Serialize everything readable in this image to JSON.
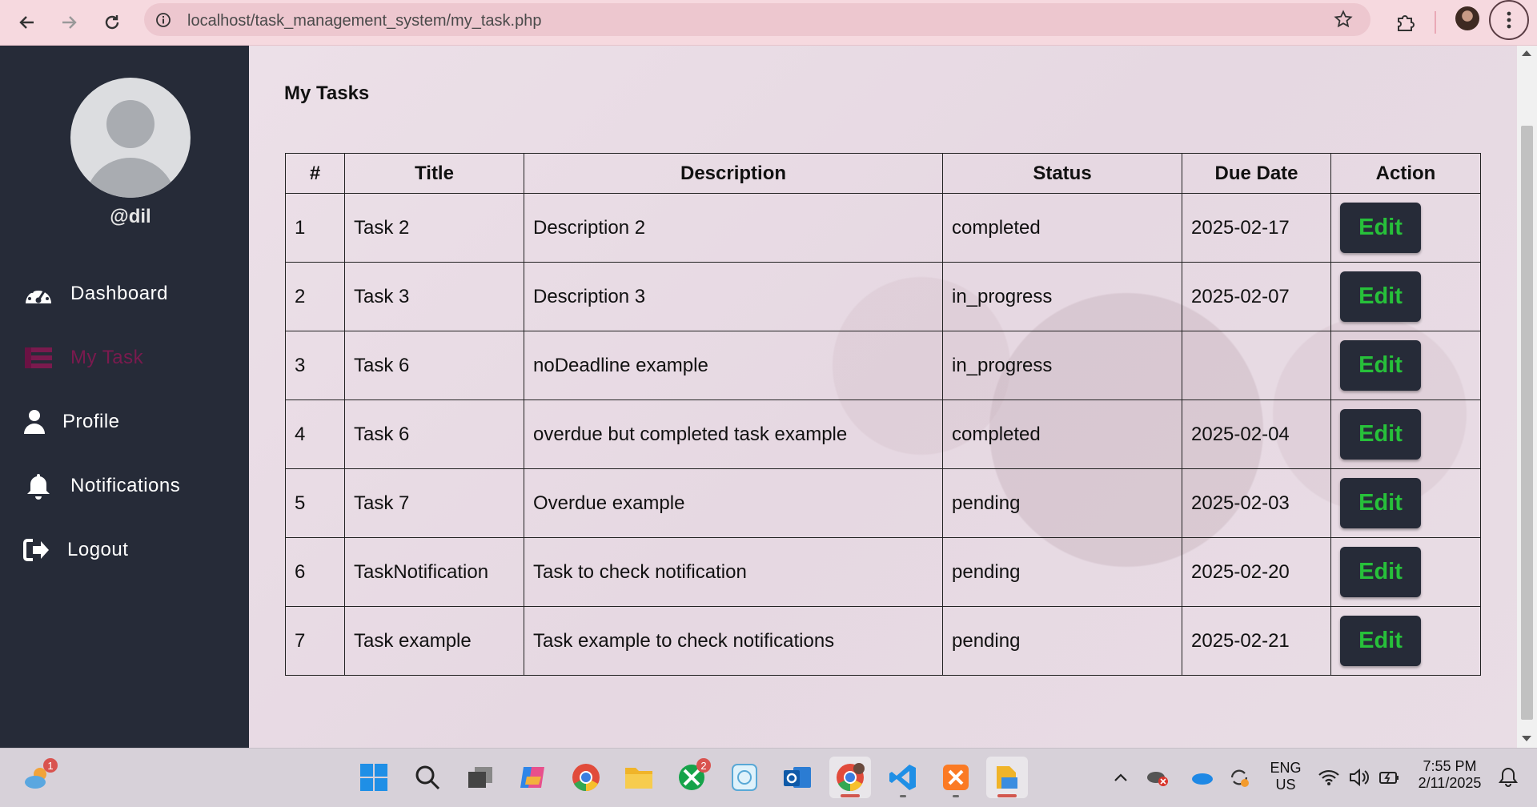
{
  "browser": {
    "url": "localhost/task_management_system/my_task.php"
  },
  "sidebar": {
    "username": "@dil",
    "items": [
      {
        "label": "Dashboard",
        "icon": "dashboard-gauge-icon"
      },
      {
        "label": "My Task",
        "icon": "task-list-icon",
        "active": true
      },
      {
        "label": "Profile",
        "icon": "user-icon"
      },
      {
        "label": "Notifications",
        "icon": "bell-icon"
      },
      {
        "label": "Logout",
        "icon": "logout-icon"
      }
    ]
  },
  "main": {
    "title": "My Tasks",
    "table": {
      "headers": [
        "#",
        "Title",
        "Description",
        "Status",
        "Due Date",
        "Action"
      ],
      "rows": [
        {
          "num": "1",
          "title": "Task 2",
          "description": "Description 2",
          "status": "completed",
          "due": "2025-02-17",
          "action": "Edit"
        },
        {
          "num": "2",
          "title": "Task 3",
          "description": "Description 3",
          "status": "in_progress",
          "due": "2025-02-07",
          "action": "Edit"
        },
        {
          "num": "3",
          "title": "Task 6",
          "description": "noDeadline example",
          "status": "in_progress",
          "due": "",
          "action": "Edit"
        },
        {
          "num": "4",
          "title": "Task 6",
          "description": "overdue but completed task example",
          "status": "completed",
          "due": "2025-02-04",
          "action": "Edit"
        },
        {
          "num": "5",
          "title": "Task 7",
          "description": "Overdue example",
          "status": "pending",
          "due": "2025-02-03",
          "action": "Edit"
        },
        {
          "num": "6",
          "title": "TaskNotification",
          "description": "Task to check notification",
          "status": "pending",
          "due": "2025-02-20",
          "action": "Edit"
        },
        {
          "num": "7",
          "title": "Task example",
          "description": "Task example to check notifications",
          "status": "pending",
          "due": "2025-02-21",
          "action": "Edit"
        }
      ]
    }
  },
  "taskbar": {
    "weather_badge": "1",
    "xbox_badge": "2",
    "language": "ENG",
    "region": "US",
    "time": "7:55 PM",
    "date": "2/11/2025"
  },
  "colors": {
    "sidebar_bg": "#262b38",
    "active_nav": "#7a1a4e",
    "edit_text": "#27c03a",
    "chrome_bg": "#f6d9df"
  }
}
